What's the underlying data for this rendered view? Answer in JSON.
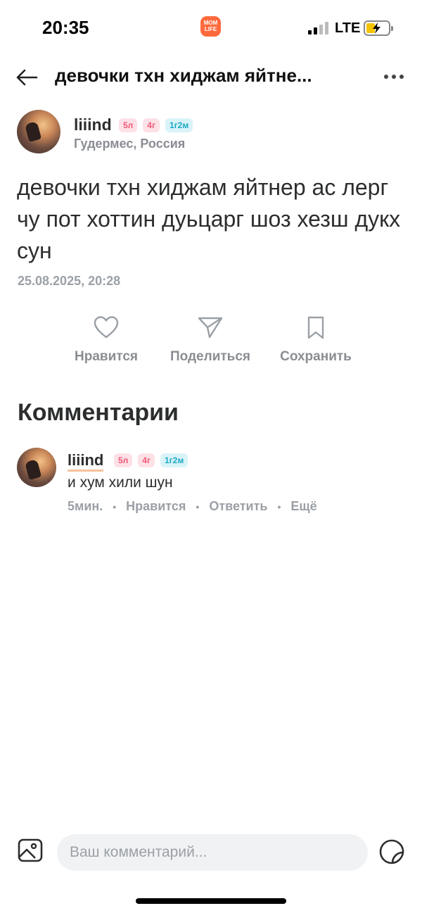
{
  "status_bar": {
    "time": "20:35",
    "app_badge_line1": "MOM",
    "app_badge_line2": "LIFE",
    "network": "LTE",
    "battery_color": "#f5c400"
  },
  "header": {
    "title": "девочки тхн хиджам яйтне...",
    "back_icon": "arrow-left-icon",
    "more_icon": "more-horizontal-icon"
  },
  "post": {
    "author": {
      "name": "liiind",
      "badges": [
        "5л",
        "4г",
        "1г2м"
      ],
      "location": "Гудермес, Россия"
    },
    "text": "девочки тхн хиджам яйтнер ас лерг чу пот хоттин  дуьцарг шоз хезш дукх сун",
    "date": "25.08.2025, 20:28"
  },
  "actions": {
    "like": {
      "label": "Нравится",
      "icon": "heart-icon"
    },
    "share": {
      "label": "Поделиться",
      "icon": "send-icon"
    },
    "save": {
      "label": "Сохранить",
      "icon": "bookmark-icon"
    }
  },
  "comments": {
    "title": "Комментарии",
    "items": [
      {
        "name": "liiind",
        "badges": [
          "5л",
          "4г",
          "1г2м"
        ],
        "text": "и хум хили шун",
        "time": "5мин.",
        "like": "Нравится",
        "reply": "Ответить",
        "more": "Ещё"
      }
    ]
  },
  "composer": {
    "placeholder": "Ваш комментарий...",
    "image_icon": "image-icon",
    "sticker_icon": "sticker-icon"
  },
  "colors": {
    "badge_pink_text": "#f05a78",
    "badge_pink_bg": "#fde1e6",
    "badge_blue_text": "#1aa9c4",
    "badge_blue_bg": "#d9f3f8",
    "muted": "#9ba0a6"
  }
}
